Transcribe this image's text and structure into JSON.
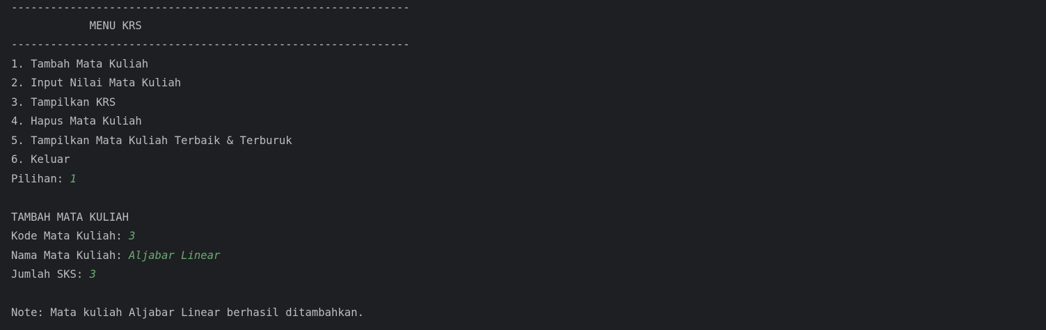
{
  "console": {
    "lines": [
      {
        "text": "-------------------------------------------------------------",
        "input": ""
      },
      {
        "text": "            MENU KRS",
        "input": ""
      },
      {
        "text": "-------------------------------------------------------------",
        "input": ""
      },
      {
        "text": "1. Tambah Mata Kuliah",
        "input": ""
      },
      {
        "text": "2. Input Nilai Mata Kuliah",
        "input": ""
      },
      {
        "text": "3. Tampilkan KRS",
        "input": ""
      },
      {
        "text": "4. Hapus Mata Kuliah",
        "input": ""
      },
      {
        "text": "5. Tampilkan Mata Kuliah Terbaik & Terburuk",
        "input": ""
      },
      {
        "text": "6. Keluar",
        "input": ""
      },
      {
        "text": "Pilihan: ",
        "input": "1"
      },
      {
        "text": "",
        "input": ""
      },
      {
        "text": "TAMBAH MATA KULIAH",
        "input": ""
      },
      {
        "text": "Kode Mata Kuliah: ",
        "input": "3"
      },
      {
        "text": "Nama Mata Kuliah: ",
        "input": "Aljabar Linear"
      },
      {
        "text": "Jumlah SKS: ",
        "input": "3"
      },
      {
        "text": "",
        "input": ""
      },
      {
        "text": "Note: Mata kuliah Aljabar Linear berhasil ditambahkan.",
        "input": ""
      }
    ]
  },
  "colors": {
    "background": "#1e1f22",
    "text": "#bcbec4",
    "user_input": "#6aab73"
  }
}
